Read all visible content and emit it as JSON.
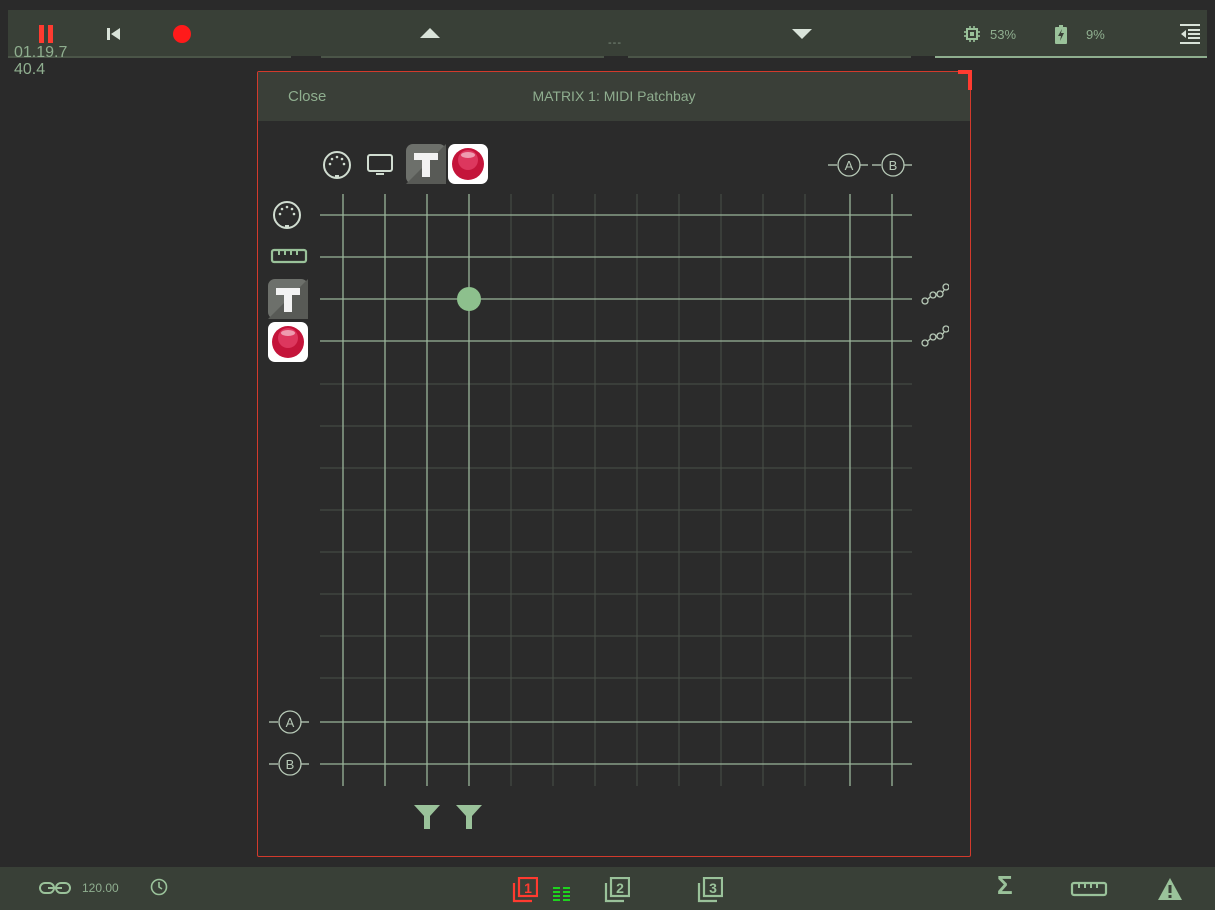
{
  "topbar": {
    "dashes": "---",
    "cpu_percent": "53%",
    "battery_percent": "9%"
  },
  "readout": {
    "position": "01.19.7",
    "value": "40.4"
  },
  "panel": {
    "close_label": "Close",
    "title": "MATRIX 1:  MIDI Patchbay"
  },
  "matrix": {
    "column_sources": [
      "midi-din",
      "monitor",
      "text-t-app",
      "red-orb-app"
    ],
    "row_sources": [
      "midi-din",
      "ruler",
      "text-t-app",
      "red-orb-app"
    ],
    "aux_columns": [
      "A",
      "B"
    ],
    "aux_rows": [
      "A",
      "B"
    ],
    "connections": [
      {
        "row": "text-t-app",
        "column": "red-orb-app"
      }
    ],
    "column_filters": [
      "text-t-app",
      "red-orb-app"
    ],
    "row_routes": [
      "text-t-app",
      "red-orb-app"
    ]
  },
  "bottombar": {
    "bpm": "120.00",
    "page_buttons": [
      "1",
      "2",
      "3"
    ]
  },
  "colors": {
    "accent_red": "#ff3b30",
    "grid_green": "#9ab59a",
    "bar_bg": "#394037"
  }
}
